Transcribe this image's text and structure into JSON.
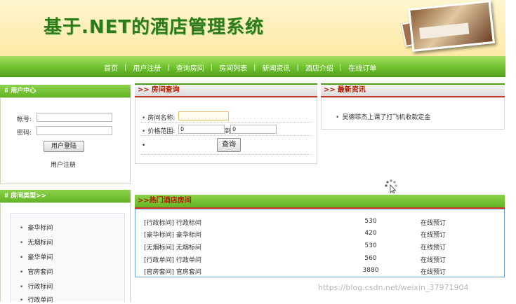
{
  "header": {
    "site_title": "基于.NET的酒店管理系统"
  },
  "nav": {
    "items": [
      "首页",
      "用户注册",
      "查询房间",
      "房间列表",
      "新闻资讯",
      "酒店介绍",
      "在线订单"
    ],
    "separator": "|"
  },
  "user_center": {
    "title": "用户中心",
    "account_label": "帐号:",
    "password_label": "密码:",
    "account_value": "",
    "password_value": "",
    "login_button": "用户登陆",
    "register_link": "用户注册"
  },
  "room_types": {
    "title": "房间类型>>",
    "items": [
      "豪华标间",
      "无烟标间",
      "豪华单间",
      "官房套间",
      "行政标间",
      "行政单间"
    ]
  },
  "room_search": {
    "title": "房间查询",
    "room_name_label": "房间名称:",
    "room_name_value": "",
    "price_label": "价格范围:",
    "price_from": "0",
    "to_label": "到",
    "price_to": "0",
    "search_button": "查询"
  },
  "news": {
    "title": "最新资讯",
    "items": [
      "吴德菲杰上课了打飞机收款定金"
    ]
  },
  "hot_rooms": {
    "title": "热门酒店房间",
    "rows": [
      {
        "name": "[行政标间] 行政标间",
        "price": "530",
        "action": "在线预订"
      },
      {
        "name": "[豪华标间] 豪华标间",
        "price": "420",
        "action": "在线预订"
      },
      {
        "name": "[无烟标间] 无烟标间",
        "price": "530",
        "action": "在线预订"
      },
      {
        "name": "[行政单间] 行政单间",
        "price": "560",
        "action": "在线预订"
      },
      {
        "name": "[官房套间] 官房套间",
        "price": "3880",
        "action": "在线预订"
      }
    ]
  },
  "watermark": "https://blog.csdn.net/weixin_37971904",
  "colors": {
    "brand_green": "#63b425",
    "title_red": "#b01c00",
    "accent_line": "#c73a2a",
    "header_bg": "#fde9a6"
  }
}
